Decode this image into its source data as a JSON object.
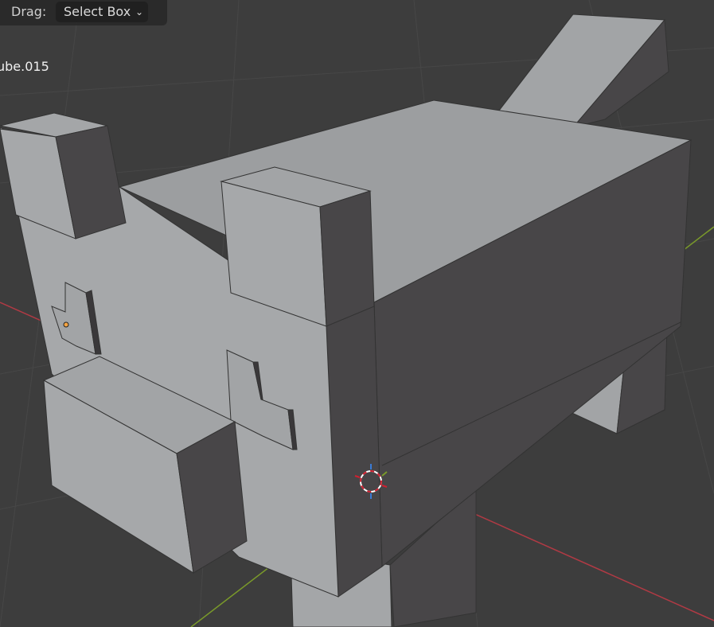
{
  "header": {
    "drag_label": "Drag:",
    "drag_mode": "Select Box",
    "prev_dropdown_chevron": "chevron-down-icon"
  },
  "viewport": {
    "object_name": "ube.015",
    "colors": {
      "background": "#3d3d3d",
      "light_face": "#a4a6a8",
      "top_face": "#9c9ea0",
      "dark_face": "#484648",
      "x_axis": "#b03a44",
      "y_axis": "#7a9a2a",
      "origin": "#f5a442"
    }
  }
}
